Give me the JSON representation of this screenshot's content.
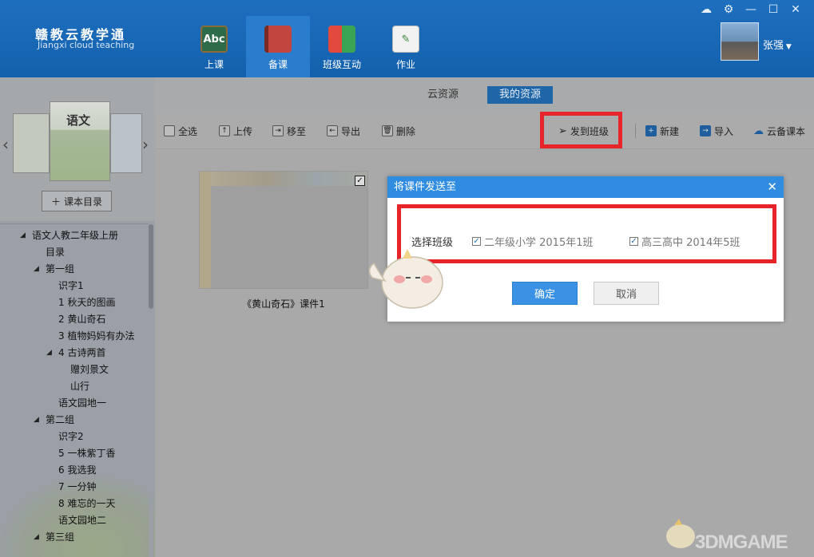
{
  "app": {
    "title_cn": "赣教云教学通",
    "title_en": "Jiangxi cloud teaching",
    "user_name": "张强"
  },
  "nav": [
    {
      "label": "上课",
      "icon": "abc-board-icon",
      "icon_text": "Abc"
    },
    {
      "label": "备课",
      "icon": "book-icon",
      "icon_text": ""
    },
    {
      "label": "班级互动",
      "icon": "blocks-icon",
      "icon_text": ""
    },
    {
      "label": "作业",
      "icon": "pen-paper-icon",
      "icon_text": ""
    }
  ],
  "tabs": {
    "cloud": "云资源",
    "mine": "我的资源"
  },
  "toolbar": {
    "select_all": "全选",
    "upload": "上传",
    "move": "移至",
    "export": "导出",
    "delete": "删除",
    "send_to_class": "发到班级",
    "new": "新建",
    "import": "导入",
    "cloud_prepare": "云备课本"
  },
  "left": {
    "book_title": "语文",
    "catalog_button": "课本目录",
    "tree": [
      {
        "label": "语文人教二年级上册",
        "level": 0,
        "expandable": true
      },
      {
        "label": "目录",
        "level": 1,
        "expandable": false
      },
      {
        "label": "第一组",
        "level": 1,
        "expandable": true
      },
      {
        "label": "识字1",
        "level": 2,
        "expandable": false
      },
      {
        "label": "1 秋天的图画",
        "level": 2,
        "expandable": false
      },
      {
        "label": "2 黄山奇石",
        "level": 2,
        "expandable": false
      },
      {
        "label": "3 植物妈妈有办法",
        "level": 2,
        "expandable": false
      },
      {
        "label": "4 古诗两首",
        "level": 2,
        "expandable": true
      },
      {
        "label": "赠刘景文",
        "level": 3,
        "expandable": false
      },
      {
        "label": "山行",
        "level": 3,
        "expandable": false
      },
      {
        "label": "语文园地一",
        "level": 2,
        "expandable": false
      },
      {
        "label": "第二组",
        "level": 1,
        "expandable": true
      },
      {
        "label": "识字2",
        "level": 2,
        "expandable": false
      },
      {
        "label": "5 一株紫丁香",
        "level": 2,
        "expandable": false
      },
      {
        "label": "6 我选我",
        "level": 2,
        "expandable": false
      },
      {
        "label": "7 一分钟",
        "level": 2,
        "expandable": false
      },
      {
        "label": "8 难忘的一天",
        "level": 2,
        "expandable": false
      },
      {
        "label": "语文园地二",
        "level": 2,
        "expandable": false
      },
      {
        "label": "第三组",
        "level": 1,
        "expandable": true
      }
    ]
  },
  "card": {
    "label": "《黄山奇石》课件1",
    "checked": true
  },
  "dialog": {
    "title": "将课件发送至",
    "select_label": "选择班级",
    "classes": [
      {
        "label": "二年级小学 2015年1班",
        "checked": true
      },
      {
        "label": "高三高中 2014年5班",
        "checked": true
      }
    ],
    "ok": "确定",
    "cancel": "取消"
  },
  "watermark": "3DMGAME",
  "colors": {
    "header": "#1565b2",
    "accent": "#2f8ce0",
    "highlight": "#e8242b"
  }
}
